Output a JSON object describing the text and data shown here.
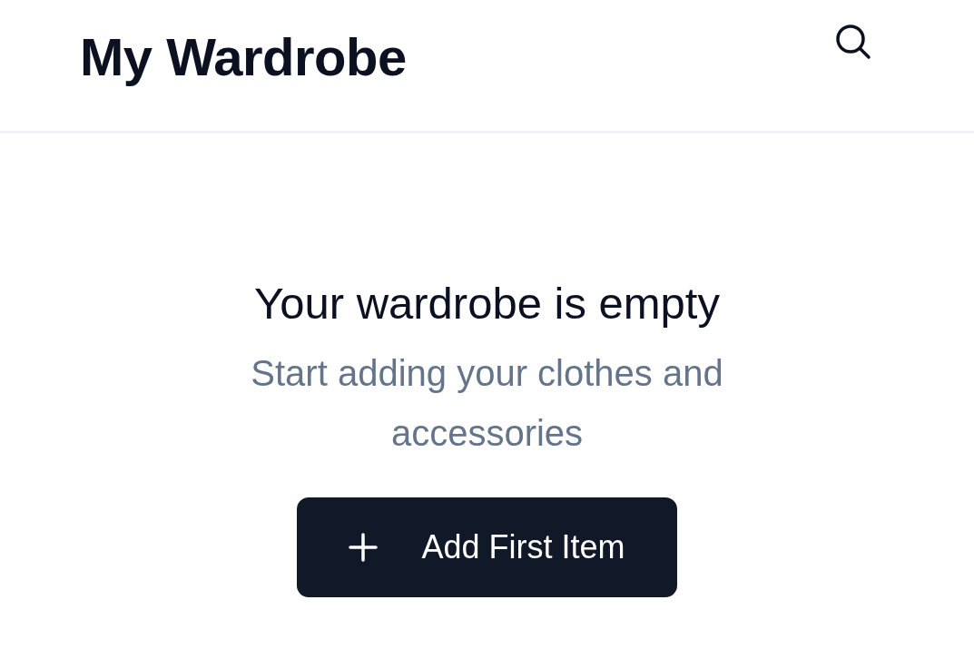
{
  "header": {
    "title": "My Wardrobe"
  },
  "empty_state": {
    "heading": "Your wardrobe is empty",
    "message": "Start adding your clothes and accessories",
    "button": "Add First Item"
  }
}
